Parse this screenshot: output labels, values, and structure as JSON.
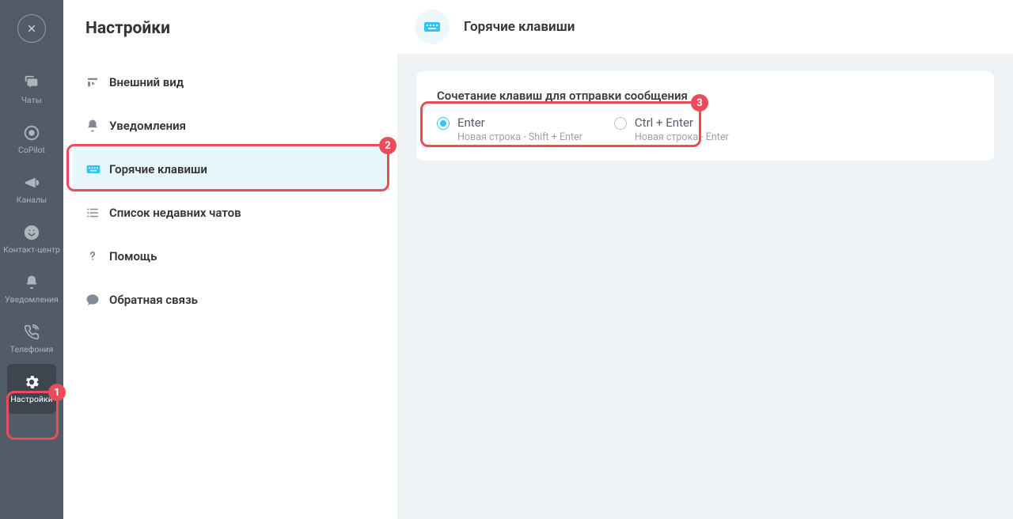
{
  "nav": {
    "items": [
      {
        "label": "Чаты",
        "icon": "chats"
      },
      {
        "label": "CoPilot",
        "icon": "copilot"
      },
      {
        "label": "Каналы",
        "icon": "channels"
      },
      {
        "label": "Контакт-центр",
        "icon": "contact"
      },
      {
        "label": "Уведомления",
        "icon": "bell"
      },
      {
        "label": "Телефония",
        "icon": "phone"
      },
      {
        "label": "Настройки",
        "icon": "gear",
        "active": true
      }
    ]
  },
  "settings": {
    "title": "Настройки",
    "items": [
      {
        "label": "Внешний вид",
        "icon": "appearance"
      },
      {
        "label": "Уведомления",
        "icon": "bell"
      },
      {
        "label": "Горячие клавиши",
        "icon": "keyboard",
        "active": true
      },
      {
        "label": "Список недавних чатов",
        "icon": "list"
      },
      {
        "label": "Помощь",
        "icon": "help"
      },
      {
        "label": "Обратная связь",
        "icon": "feedback"
      }
    ]
  },
  "content": {
    "title": "Горячие клавиши",
    "card_title": "Сочетание клавиш для отправки сообщения",
    "options": [
      {
        "label": "Enter",
        "sub": "Новая строка - Shift + Enter",
        "checked": true
      },
      {
        "label": "Ctrl + Enter",
        "sub": "Новая строка - Enter",
        "checked": false
      }
    ]
  },
  "callouts": [
    {
      "n": "1"
    },
    {
      "n": "2"
    },
    {
      "n": "3"
    }
  ]
}
